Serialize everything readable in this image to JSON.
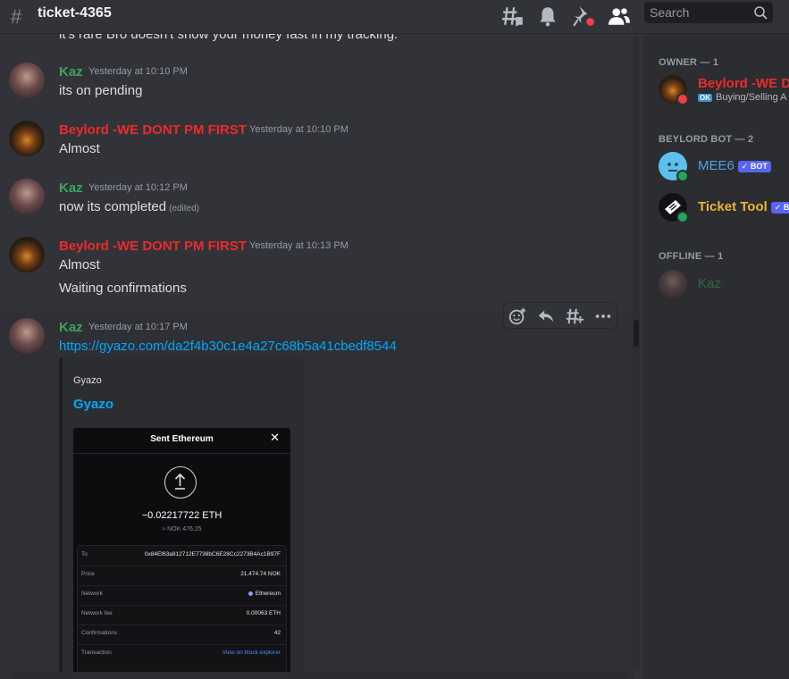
{
  "channel": {
    "name": "ticket-4365"
  },
  "search": {
    "placeholder": "Search"
  },
  "messages": [
    {
      "text": "it's rare Bro doesn't show your money fast in my tracking."
    },
    {
      "author": "Kaz",
      "time": "Yesterday at 10:10 PM",
      "text": "its on pending"
    },
    {
      "author": "Beylord  -WE DONT PM FIRST",
      "time": "Yesterday at 10:10 PM",
      "text": "Almost"
    },
    {
      "author": "Kaz",
      "time": "Yesterday at 10:12 PM",
      "text": "now its completed",
      "edited": "(edited)"
    },
    {
      "author": "Beylord  -WE DONT PM FIRST",
      "time": "Yesterday at 10:13 PM",
      "text": "Almost",
      "text2": "Waiting confirmations"
    },
    {
      "author": "Kaz",
      "time": "Yesterday at 10:17 PM",
      "link": "https://gyazo.com/da2f4b30c1e4a27c68b5a41cbedf8544"
    }
  ],
  "embed": {
    "provider": "Gyazo",
    "title": "Gyazo",
    "screenshot": {
      "title": "Sent Ethereum",
      "close": "✕",
      "amount": "−0.02217722 ETH",
      "fiat": "≈ NOK 476.25",
      "rows": [
        {
          "label": "To",
          "value": "0x84Ef63a812712E7738bC6E28Cc2273B4Ac1B97F"
        },
        {
          "label": "Price",
          "value": "21,474.74 NOK"
        },
        {
          "label": "Network",
          "value": "Ethereum"
        },
        {
          "label": "Network fee",
          "value": "0.00063 ETH"
        },
        {
          "label": "Confirmations",
          "value": "42"
        },
        {
          "label": "Transaction",
          "value": "View on block explorer"
        }
      ]
    }
  },
  "members": {
    "owner_header": "OWNER — 1",
    "owner": {
      "name": "Beylord -WE DO",
      "status": "Buying/Selling A",
      "status_badge": "OK"
    },
    "bot_header": "BEYLORD BOT — 2",
    "bots": [
      {
        "name": "MEE6",
        "badge": "✓ BOT"
      },
      {
        "name": "Ticket Tool",
        "badge": "✓ BO"
      }
    ],
    "offline_header": "OFFLINE — 1",
    "offline": [
      {
        "name": "Kaz"
      }
    ]
  },
  "colors": {
    "kaz": "#3ba55c",
    "beylord": "#ed2a2a",
    "mee6": "#4aa3e0",
    "ticket_tool": "#f0b232",
    "link": "#00a8fc"
  }
}
